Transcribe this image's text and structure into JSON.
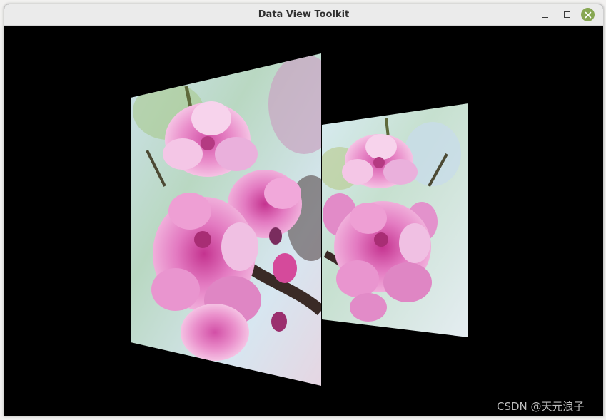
{
  "window": {
    "title": "Data View Toolkit"
  },
  "titlebar_buttons": {
    "minimize_icon": "minimize-icon",
    "maximize_icon": "maximize-icon",
    "close_icon": "close-icon",
    "close_color": "#87a752"
  },
  "scene": {
    "image_subject": "pink peach blossom photograph rendered on two perspective-warped planes"
  },
  "watermark": {
    "text": "CSDN @天元浪子"
  }
}
